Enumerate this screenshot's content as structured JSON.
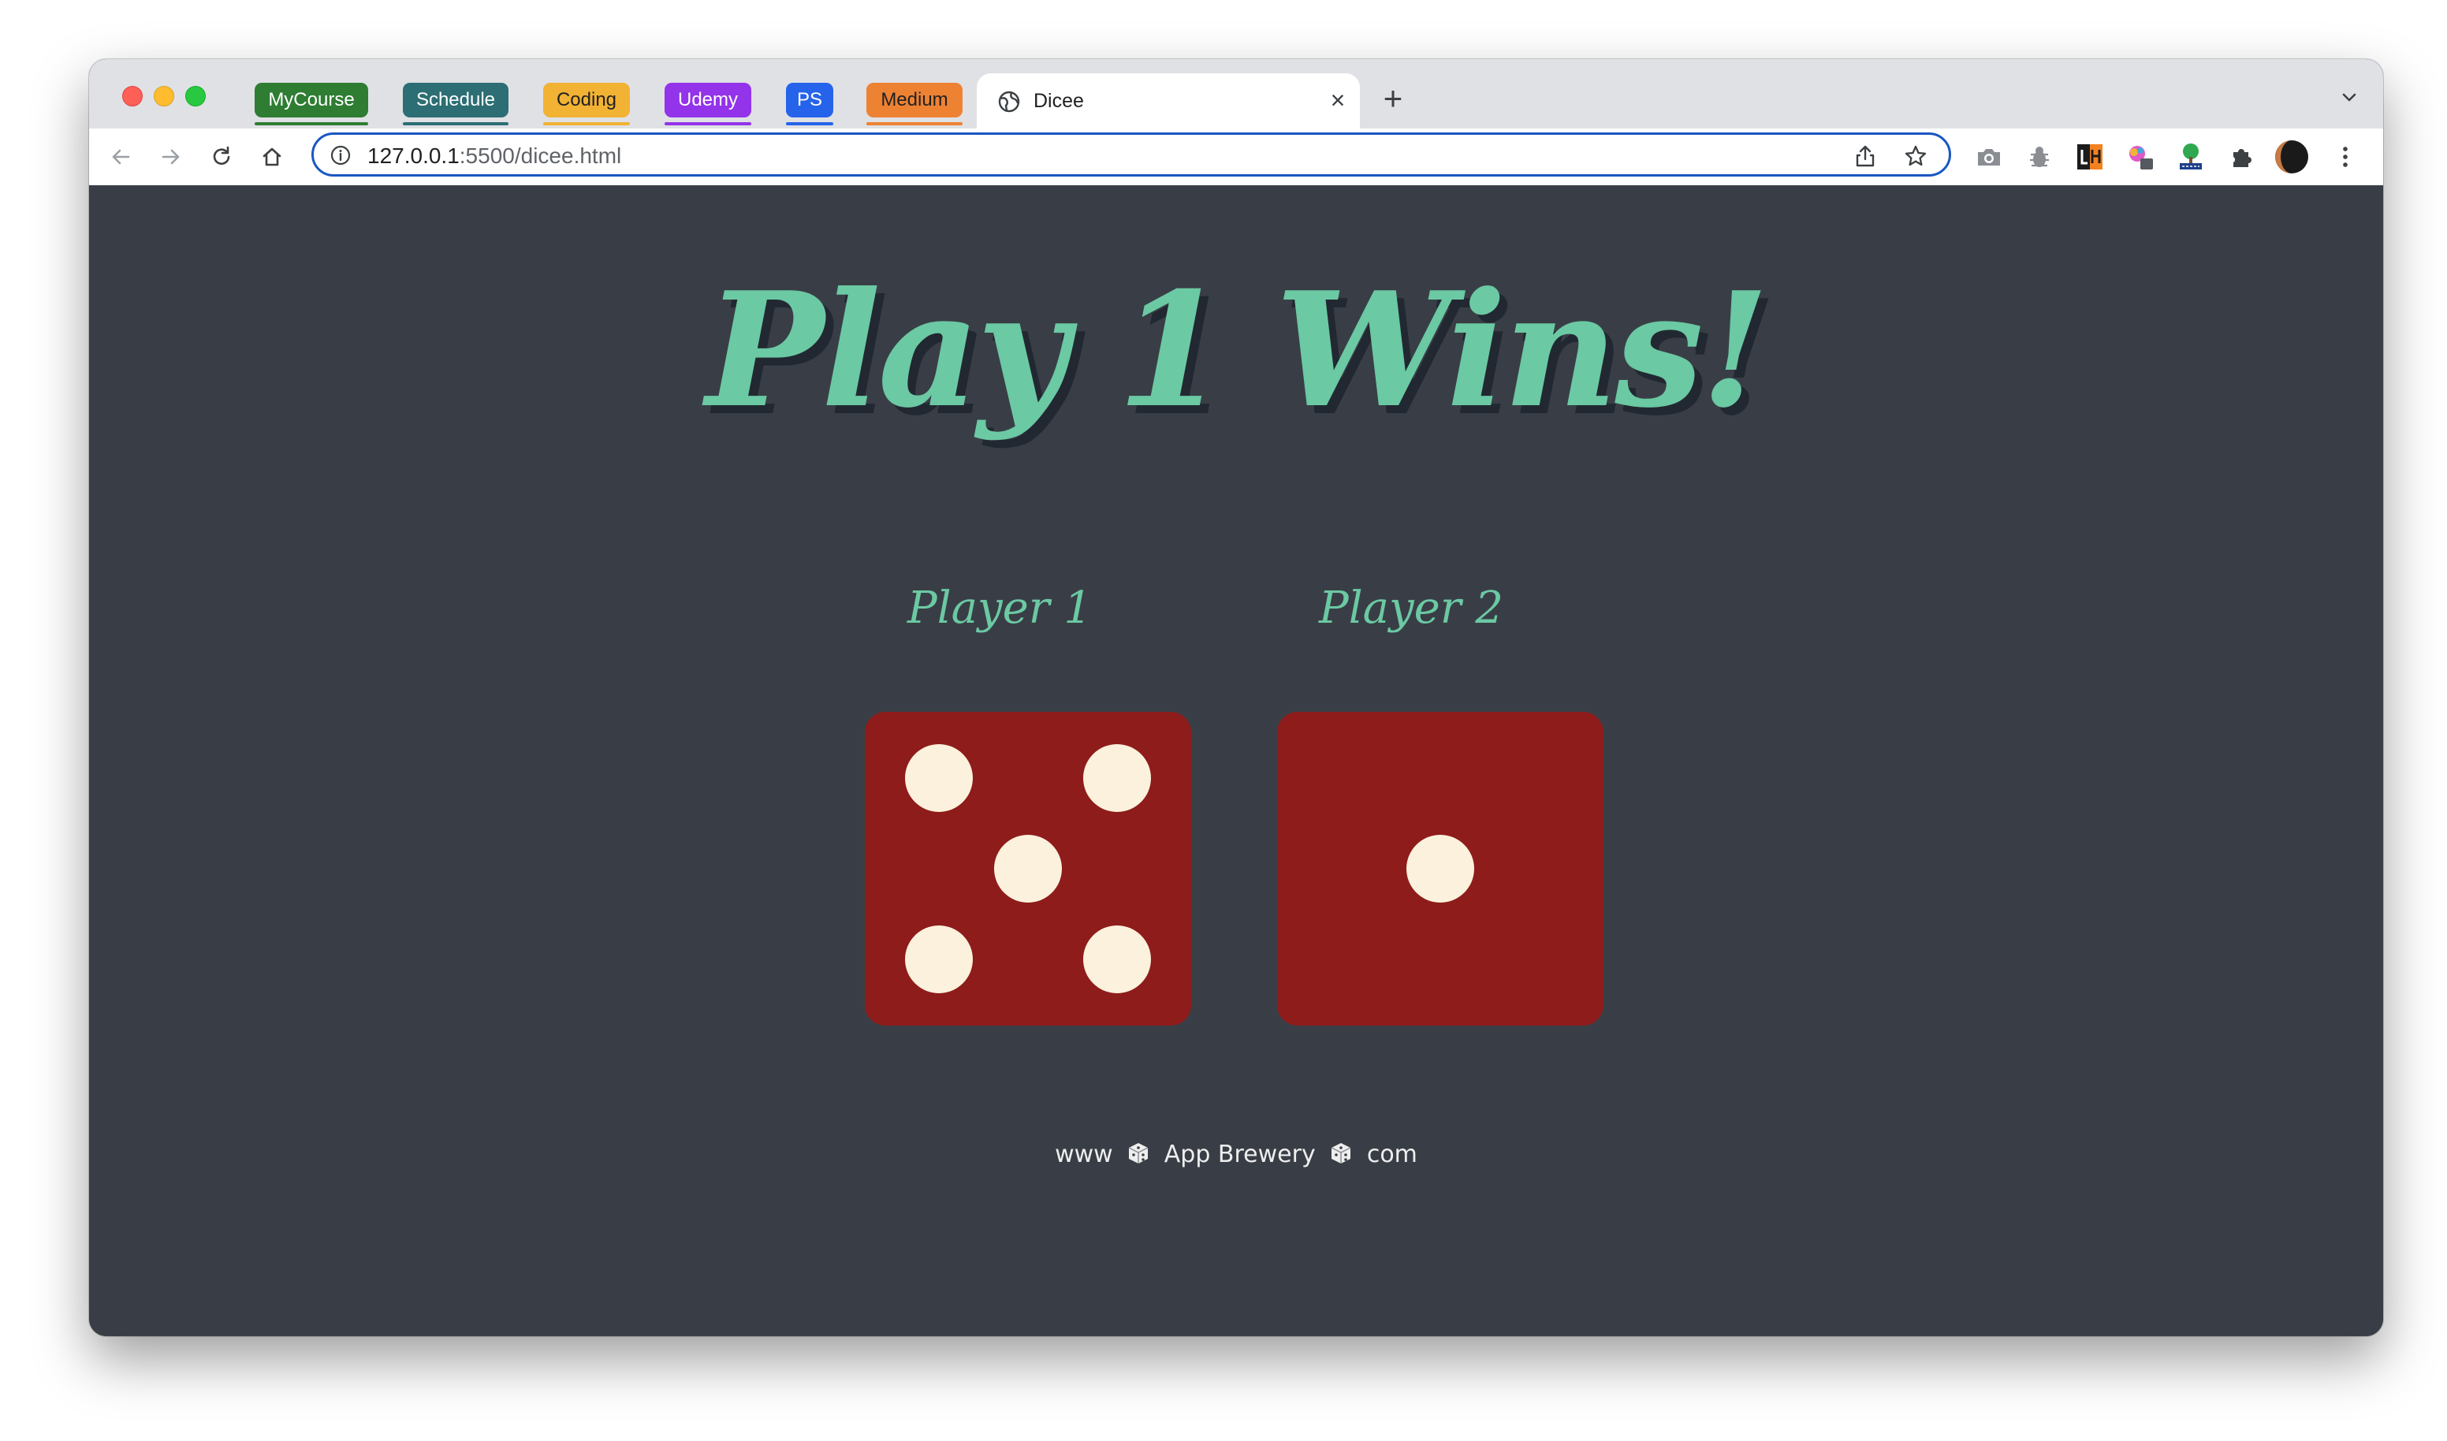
{
  "browser": {
    "tab_groups": [
      {
        "label": "MyCourse",
        "color": "#2e7d32"
      },
      {
        "label": "Schedule",
        "color": "#2c6e73"
      },
      {
        "label": "Coding",
        "color": "#f2b233"
      },
      {
        "label": "Udemy",
        "color": "#9333ea"
      },
      {
        "label": "PS",
        "color": "#2563eb"
      },
      {
        "label": "Medium",
        "color": "#ee8233"
      }
    ],
    "active_tab": {
      "title": "Dicee",
      "close_label": "×"
    },
    "new_tab_label": "+",
    "address": {
      "host": "127.0.0.1",
      "rest": ":5500/dicee.html"
    }
  },
  "page": {
    "headline": "Play 1 Wins!",
    "player1_label": "Player 1",
    "player2_label": "Player 2",
    "die1_value": 5,
    "die2_value": 1,
    "die_color": "#8e1c1a",
    "pip_color": "#fbf1dc",
    "accent_color": "#6bc9a3",
    "background_color": "#393e46",
    "footer": {
      "prefix": "www",
      "name": "App Brewery",
      "suffix": "com"
    }
  }
}
